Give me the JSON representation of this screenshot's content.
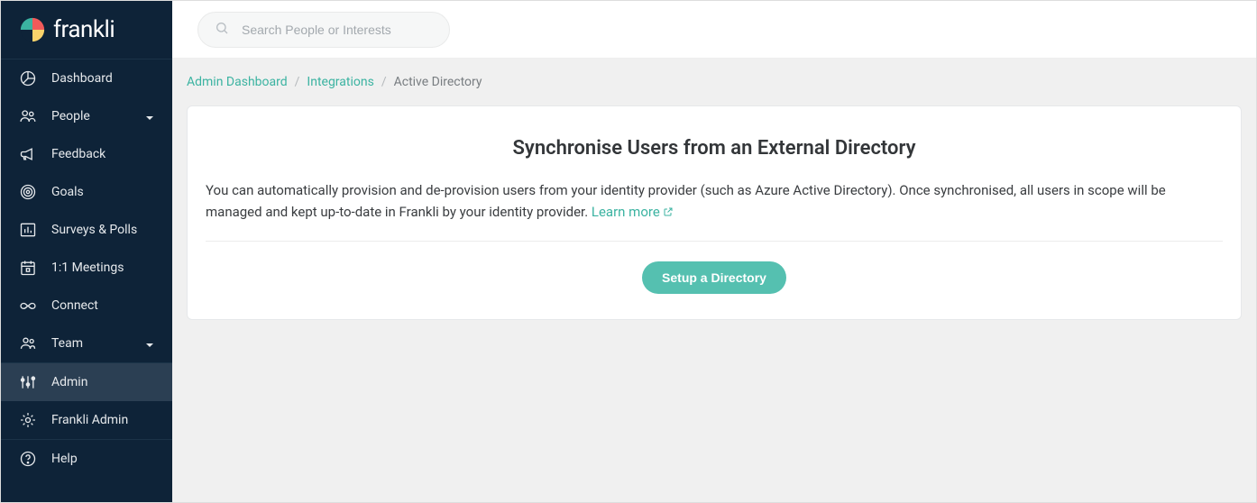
{
  "brand": {
    "name": "frankli"
  },
  "search": {
    "placeholder": "Search People or Interests"
  },
  "sidebar": {
    "items": [
      {
        "label": "Dashboard",
        "icon": "pie",
        "chevron": false
      },
      {
        "label": "People",
        "icon": "people",
        "chevron": true
      },
      {
        "label": "Feedback",
        "icon": "megaphone",
        "chevron": false
      },
      {
        "label": "Goals",
        "icon": "target",
        "chevron": false
      },
      {
        "label": "Surveys & Polls",
        "icon": "chart",
        "chevron": false
      },
      {
        "label": "1:1 Meetings",
        "icon": "calendar",
        "chevron": false
      },
      {
        "label": "Connect",
        "icon": "infinity",
        "chevron": false
      },
      {
        "label": "Team",
        "icon": "team",
        "chevron": true
      },
      {
        "label": "Admin",
        "icon": "sliders",
        "chevron": false,
        "active": true
      },
      {
        "label": "Frankli Admin",
        "icon": "gear",
        "chevron": false
      },
      {
        "label": "Help",
        "icon": "help",
        "chevron": false
      }
    ]
  },
  "breadcrumb": {
    "items": [
      {
        "label": "Admin Dashboard",
        "link": true
      },
      {
        "label": "Integrations",
        "link": true
      },
      {
        "label": "Active Directory",
        "link": false
      }
    ]
  },
  "panel": {
    "title": "Synchronise Users from an External Directory",
    "body": "You can automatically provision and de-provision users from your identity provider (such as Azure Active Directory). Once synchronised, all users in scope will be managed and kept up-to-date in Frankli by your identity provider. ",
    "learn_more": "Learn more",
    "button": "Setup a Directory"
  }
}
